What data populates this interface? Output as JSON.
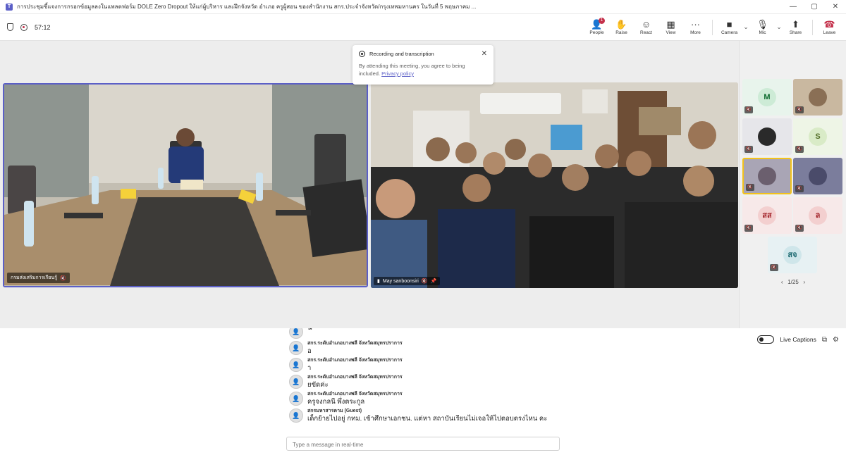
{
  "window": {
    "title": "การประชุมชี้แจงการกรอกข้อมูลลงในแพลตฟอร์ม DOLE Zero Dropout ให้แก่ผู้บริหาร และฝึกจังหวัด อำเภอ ครูผู้สอน ของสำนักงาน สกร.ประจำจังหวัด/กรุงเทพมหานคร ในวันที่ 5 พฤษภาคม ...",
    "minimize": "—",
    "maximize": "▢",
    "close": "✕"
  },
  "toolbar": {
    "timer": "57:12",
    "buttons": [
      {
        "label": "People",
        "icon": "people-icon",
        "glyph": "👤",
        "badge": "1"
      },
      {
        "label": "Raise",
        "icon": "raise-hand-icon",
        "glyph": "✋"
      },
      {
        "label": "React",
        "icon": "react-icon",
        "glyph": "☺"
      },
      {
        "label": "View",
        "icon": "view-icon",
        "glyph": "▦"
      },
      {
        "label": "More",
        "icon": "more-icon",
        "glyph": "···"
      }
    ],
    "camera_label": "Camera",
    "mic_label": "Mic",
    "share_label": "Share",
    "leave_label": "Leave"
  },
  "notice": {
    "title": "Recording and transcription",
    "body": "By attending this meeting, you agree to being included.",
    "link": "Privacy policy"
  },
  "stage": {
    "left_name": "กรมส่งเสริมการเรียนรู้",
    "right_name": "May sanboonsiri"
  },
  "gallery": {
    "tiles": [
      {
        "initials": "M",
        "bg": "#e8f4ec",
        "fg": "#0b6a2c",
        "avbg": "#cdebd6"
      },
      {
        "initials": "",
        "bg": "#c9b8a0",
        "fg": "#333",
        "avbg": "#8a6f55"
      },
      {
        "initials": "",
        "bg": "#e6e6ea",
        "fg": "#333",
        "avbg": "#2a2a2a"
      },
      {
        "initials": "S",
        "bg": "#eef5e6",
        "fg": "#55712a",
        "avbg": "#d9ebc7"
      },
      {
        "initials": "",
        "bg": "#a9a5b5",
        "fg": "#333",
        "avbg": "#6b5f6e"
      },
      {
        "initials": "",
        "bg": "#7b7d9c",
        "fg": "#333",
        "avbg": "#4a4b6a"
      },
      {
        "initials": "สส",
        "bg": "#f7e9e9",
        "fg": "#a4262c",
        "avbg": "#f3cfcf"
      },
      {
        "initials": "ล",
        "bg": "#f7e9e9",
        "fg": "#a4262c",
        "avbg": "#f3cfcf"
      },
      {
        "initials": "สจ",
        "bg": "#e7f1f3",
        "fg": "#1f6b72",
        "avbg": "#cfe6ea"
      }
    ],
    "page": "1/25"
  },
  "chat": {
    "messages": [
      {
        "sender": "",
        "text": "น"
      },
      {
        "sender": "สกร.ระดับอำเภอบางพลี จังหวัดสมุทรปราการ",
        "text": "อ"
      },
      {
        "sender": "สกร.ระดับอำเภอบางพลี จังหวัดสมุทรปราการ",
        "text": "า"
      },
      {
        "sender": "สกร.ระดับอำเภอบางพลี จังหวัดสมุทรปราการ",
        "text": "ยขัดค่ะ"
      },
      {
        "sender": "สกร.ระดับอำเภอบางพลี จังหวัดสมุทรปราการ",
        "text": "ครูจงกลนี พึ่งตระกูล"
      },
      {
        "sender": "สกรมหาสารคาม (Guest)",
        "text": "เด็กย้ายไปอยู่ กทม. เข้าศึกษาเอกชน. แต่หา สถาบันเรียนไม่เจอให้ไปตอบตรงไหน คะ"
      }
    ],
    "placeholder": "Type a message in real-time"
  },
  "captions": {
    "label": "Live Captions"
  }
}
